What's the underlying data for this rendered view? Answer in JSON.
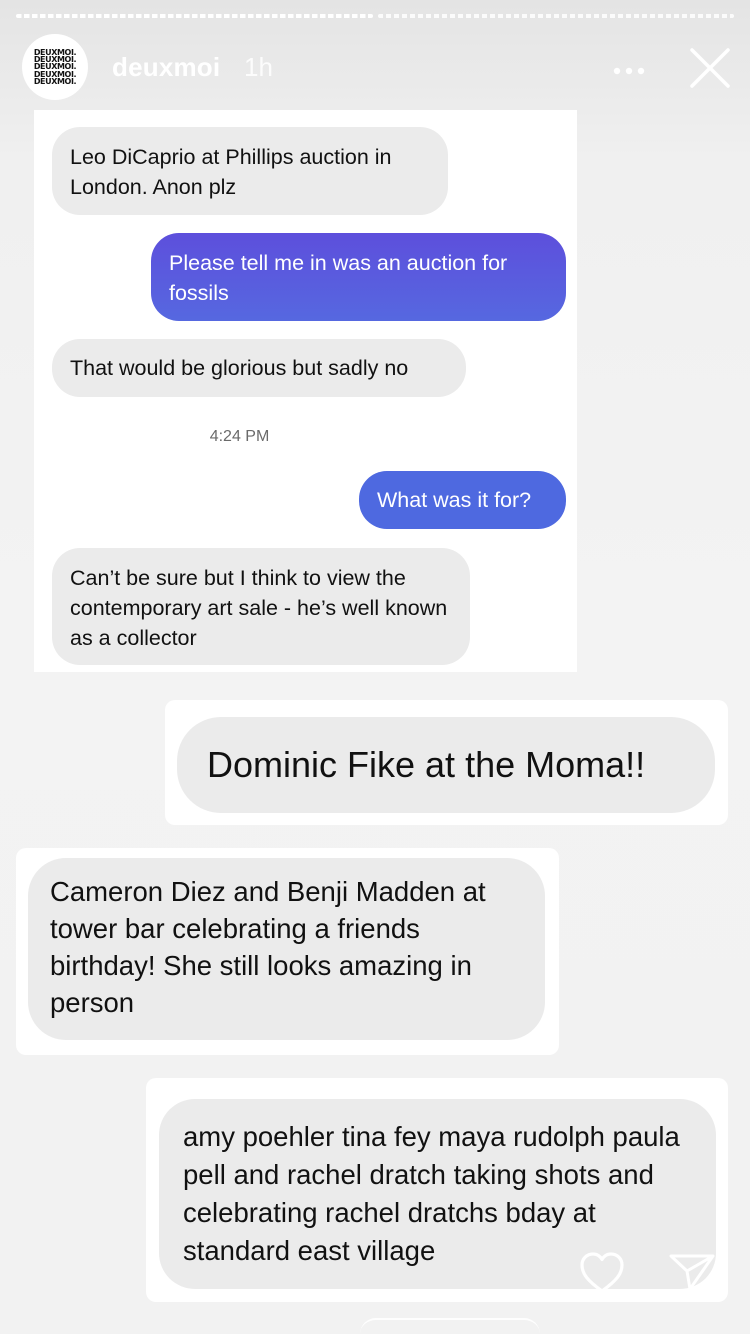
{
  "story": {
    "username": "deuxmoi",
    "time_ago": "1h",
    "avatar_text": [
      "DEUXMOI.",
      "DEUXMOI.",
      "DEUXMOI.",
      "DEUXMOI.",
      "DEUXMOI."
    ],
    "progress": {
      "segments": 2,
      "current": 1
    }
  },
  "chat1": {
    "msg1": "Leo DiCaprio at Phillips auction in London. Anon plz",
    "msg2": "Please tell me in was an auction for fossils",
    "msg3": "That would be glorious but sadly no",
    "timestamp": "4:24 PM",
    "msg4": "What was it for?",
    "msg5": "Can’t be sure but I think to view the contemporary art sale - he’s well known as a collector"
  },
  "chat2": {
    "msg": "Dominic Fike at the Moma!!"
  },
  "chat3": {
    "msg": "Cameron Diez and Benji Madden at tower bar celebrating a friends birthday! She still looks amazing in person"
  },
  "chat4": {
    "msg": "amy poehler tina fey maya rudolph paula pell and rachel dratch taking shots and celebrating rachel dratchs bday at standard east village"
  },
  "colors": {
    "sent_gradient_top": "#5a4fdc",
    "sent_gradient_bottom": "#4f6ee0",
    "received_bubble": "#ebebeb"
  },
  "icons": {
    "more": "more-horizontal-icon",
    "close": "close-icon",
    "like": "heart-icon",
    "share": "send-icon"
  }
}
